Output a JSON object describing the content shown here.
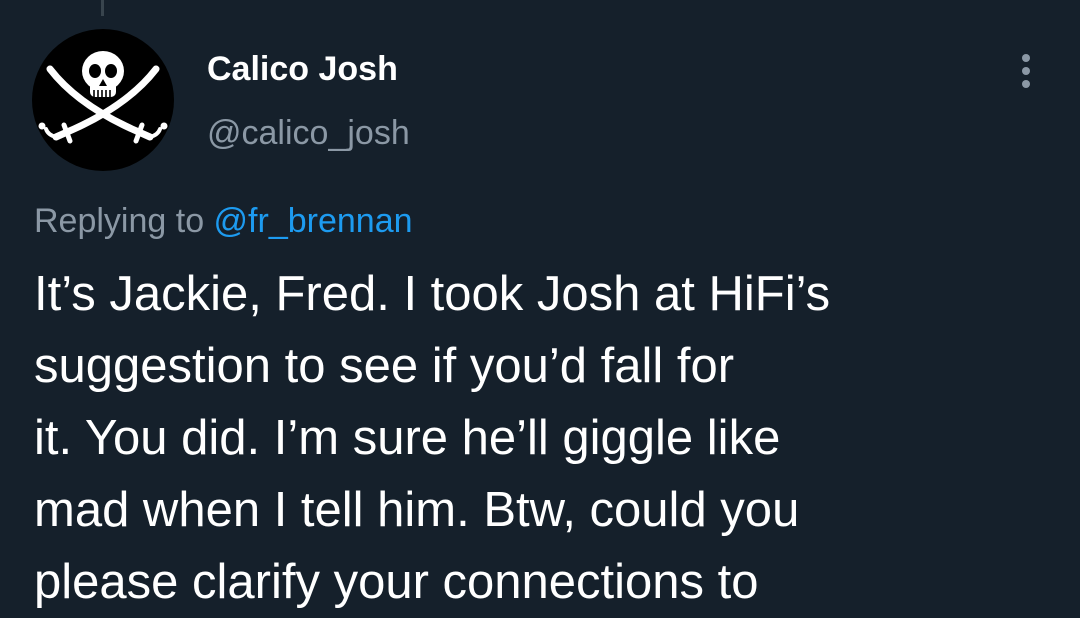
{
  "tweet": {
    "author": {
      "display_name": "Calico Josh",
      "handle": "@calico_josh",
      "avatar_icon": "jolly-roger-skull-crossed-swords-icon"
    },
    "more_icon": "more-options-icon",
    "replying_to_prefix": "Replying to ",
    "replying_to_handle": "@fr_brennan",
    "text": "It’s Jackie, Fred. I took Josh at HiFi’s\nsuggestion to see if you’d fall for\nit. You did. I’m sure he’ll giggle like\nmad when I tell him. Btw, could you\nplease clarify your connections to"
  },
  "colors": {
    "background": "#15202b",
    "primary_text": "#ffffff",
    "secondary_text": "#8b98a5",
    "link": "#1d9bf0",
    "thread_line": "#38444d"
  }
}
